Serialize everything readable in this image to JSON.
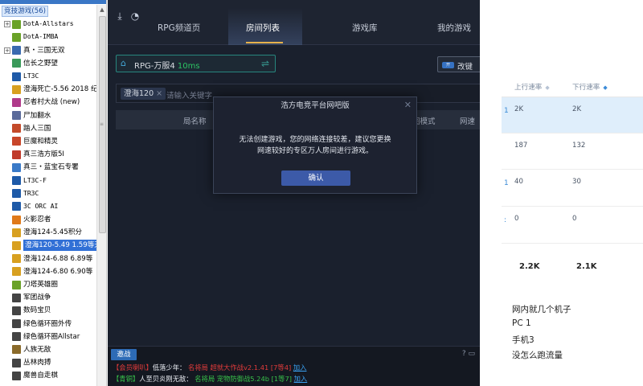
{
  "tree": {
    "root_label": "竞技游戏(56)",
    "items": [
      {
        "label": "DotA-Allstars",
        "icon": "dota-icon",
        "color": "#6aa228",
        "mono": true,
        "expand": true
      },
      {
        "label": "DotA-IMBA",
        "icon": "dota-icon",
        "color": "#6aa228",
        "mono": true
      },
      {
        "label": "真・三国无双",
        "icon": "sanguo-icon",
        "color": "#3a6ab0",
        "expand": true
      },
      {
        "label": "信长之野望",
        "icon": "map-icon",
        "color": "#3a9a5a"
      },
      {
        "label": "LT3C",
        "icon": "lt-icon",
        "color": "#1e5aa8",
        "mono": true
      },
      {
        "label": "澄海死亡-5.56 2018 纪",
        "icon": "chenghai-icon",
        "color": "#d8a020"
      },
      {
        "label": "忍者村大战 (new)",
        "icon": "ninja-icon",
        "color": "#b03a8a"
      },
      {
        "label": "尸加翻水",
        "icon": "map-icon",
        "color": "#5a6a9a"
      },
      {
        "label": "踏人三国",
        "icon": "sanguo-icon",
        "color": "#c44a2a"
      },
      {
        "label": "巨魔和精灵",
        "icon": "troll-icon",
        "color": "#c8462a"
      },
      {
        "label": "真三浩方版5I",
        "icon": "sanguo-icon",
        "color": "#c03a2a"
      },
      {
        "label": "真三・蓝宝石专署",
        "icon": "diamond-icon",
        "color": "#3a7ac8"
      },
      {
        "label": "LT3C-F",
        "icon": "lt-icon",
        "color": "#1e5aa8",
        "mono": true
      },
      {
        "label": "TR3C",
        "icon": "lt-icon",
        "color": "#1e5aa8",
        "mono": true
      },
      {
        "label": "3C ORC AI",
        "icon": "lt-icon",
        "color": "#1e5aa8",
        "mono": true
      },
      {
        "label": "火影忍者",
        "icon": "ninja-icon",
        "color": "#e07a1a"
      },
      {
        "label": "澄海124-5.45积分",
        "icon": "chenghai-icon",
        "color": "#d8a020"
      },
      {
        "label": "澄海120-5.49 1.59等天",
        "icon": "chenghai-icon",
        "color": "#d8a020",
        "selected": true
      },
      {
        "label": "澄海124-6.88 6.89等",
        "icon": "chenghai-icon",
        "color": "#d8a020"
      },
      {
        "label": "澄海124-6.80 6.90等",
        "icon": "chenghai-icon",
        "color": "#d8a020"
      },
      {
        "label": "刀塔英雄圈",
        "icon": "dota-icon",
        "color": "#6aa228"
      },
      {
        "label": "军团战争",
        "icon": "war-icon",
        "color": "#444444"
      },
      {
        "label": "数码宝贝",
        "icon": "war-icon",
        "color": "#444444"
      },
      {
        "label": "绿色循环圈外传",
        "icon": "war-icon",
        "color": "#444444"
      },
      {
        "label": "绿色循环圈Allstar",
        "icon": "war-icon",
        "color": "#444444"
      },
      {
        "label": "人族无敌",
        "icon": "human-icon",
        "color": "#8a6a2a"
      },
      {
        "label": "丛林肉搏",
        "icon": "war-icon",
        "color": "#444444"
      },
      {
        "label": "魔兽自走棋",
        "icon": "war-icon",
        "color": "#444444"
      }
    ]
  },
  "app": {
    "tabs": [
      "RPG频道页",
      "房间列表",
      "游戏库",
      "我的游戏"
    ],
    "active_tab": 1,
    "server": {
      "name": "RPG-万服4",
      "ping": "10ms"
    },
    "rename_label": "改键",
    "search": {
      "chip": "澄海120",
      "placeholder": "请输入关键字"
    },
    "columns": [
      "局名称",
      "图模式",
      "网速"
    ],
    "modal": {
      "title": "浩方电竞平台网吧版",
      "message_line1": "无法创建游戏，您的网络连接较差，建议您更换",
      "message_line2": "网速较好的专区万人房间进行游戏。",
      "ok": "确认"
    },
    "chat": {
      "tab": "邀战",
      "icons": "? ▭",
      "lines": [
        {
          "prefix": "【会员喇叭】",
          "name": "低落少年：",
          "text": "名将局 超就大作战v2.1.41 [7等4]",
          "link": "加入"
        },
        {
          "prefix": "【青铜】",
          "name": "人至贝炎刚无敌：",
          "text": "名将局 宠物防御战5.24b [1等7]",
          "link": "加入"
        }
      ]
    }
  },
  "web": {
    "headers": [
      "上行速率",
      "下行速率"
    ],
    "rows": [
      {
        "up": "2K",
        "down": "2K",
        "edge": "1",
        "highlight": true
      },
      {
        "up": "187",
        "down": "132",
        "edge": ""
      },
      {
        "up": "40",
        "down": "30",
        "edge": "1"
      },
      {
        "up": "0",
        "down": "0",
        "edge": ":"
      }
    ],
    "totals": {
      "up": "2.2K",
      "down": "2.1K"
    },
    "notes": [
      "网内就几个机子",
      "PC 1",
      "手机3",
      "没怎么跑流量"
    ]
  }
}
